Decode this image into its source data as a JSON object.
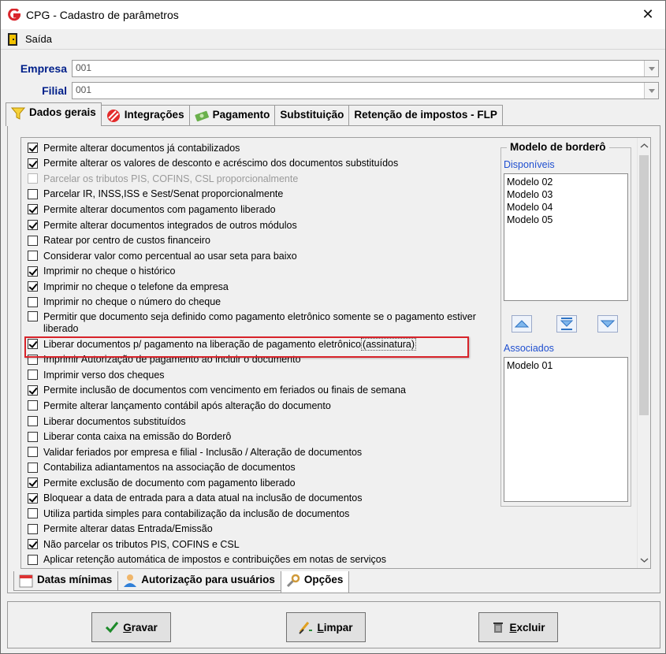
{
  "window": {
    "title": "CPG - Cadastro de parâmetros",
    "close_glyph": "✕"
  },
  "menu": {
    "exit_label": "Saída"
  },
  "fields": {
    "empresa_label": "Empresa",
    "empresa_value": "001",
    "filial_label": "Filial",
    "filial_value": "001"
  },
  "tabs": [
    {
      "label": "Dados gerais",
      "icon": "funnel-icon",
      "active": true
    },
    {
      "label": "Integrações",
      "icon": "stripes-icon",
      "active": false
    },
    {
      "label": "Pagamento",
      "icon": "money-icon",
      "active": false
    },
    {
      "label": "Substituição",
      "icon": "",
      "active": false
    },
    {
      "label": "Retenção de impostos - FLP",
      "icon": "",
      "active": false
    }
  ],
  "options": [
    {
      "label": "Permite alterar documentos já contabilizados",
      "checked": true,
      "disabled": false
    },
    {
      "label": "Permite alterar os valores de desconto e acréscimo dos documentos substituídos",
      "checked": true,
      "disabled": false
    },
    {
      "label": "Parcelar os tributos PIS, COFINS, CSL proporcionalmente",
      "checked": false,
      "disabled": true
    },
    {
      "label": "Parcelar IR, INSS,ISS e Sest/Senat proporcionalmente",
      "checked": false,
      "disabled": false
    },
    {
      "label": "Permite alterar documentos com pagamento liberado",
      "checked": true,
      "disabled": false
    },
    {
      "label": "Permite alterar documentos integrados de outros módulos",
      "checked": true,
      "disabled": false
    },
    {
      "label": "Ratear por centro de custos financeiro",
      "checked": false,
      "disabled": false
    },
    {
      "label": "Considerar valor como percentual ao usar seta para baixo",
      "checked": false,
      "disabled": false
    },
    {
      "label": "Imprimir no cheque o histórico",
      "checked": true,
      "disabled": false
    },
    {
      "label": "Imprimir no cheque o telefone da empresa",
      "checked": true,
      "disabled": false
    },
    {
      "label": "Imprimir no cheque o número do cheque",
      "checked": false,
      "disabled": false
    },
    {
      "label": "Permitir que documento seja definido como pagamento eletrônico somente se o pagamento estiver liberado",
      "checked": false,
      "disabled": false,
      "tall": true
    },
    {
      "label": "Liberar documentos p/ pagamento na liberação de pagamento eletrônico",
      "label_focus": "(assinatura)",
      "checked": true,
      "disabled": false,
      "highlighted": true
    },
    {
      "label": "Imprimir Autorização de pagamento ao incluir o documento",
      "checked": false,
      "disabled": false
    },
    {
      "label": "Imprimir verso dos cheques",
      "checked": false,
      "disabled": false
    },
    {
      "label": "Permite inclusão de documentos com vencimento em feriados ou finais de semana",
      "checked": true,
      "disabled": false
    },
    {
      "label": "Permite alterar lançamento contábil após alteração do documento",
      "checked": false,
      "disabled": false
    },
    {
      "label": "Liberar documentos substituídos",
      "checked": false,
      "disabled": false
    },
    {
      "label": "Liberar conta caixa na emissão do Borderô",
      "checked": false,
      "disabled": false
    },
    {
      "label": "Validar feriados por empresa e filial - Inclusão / Alteração de documentos",
      "checked": false,
      "disabled": false
    },
    {
      "label": "Contabiliza adiantamentos na associação de documentos",
      "checked": false,
      "disabled": false
    },
    {
      "label": "Permite exclusão de documento com pagamento liberado",
      "checked": true,
      "disabled": false
    },
    {
      "label": "Bloquear a data de entrada para a data atual na inclusão de documentos",
      "checked": true,
      "disabled": false
    },
    {
      "label": "Utiliza partida simples para contabilização da inclusão de documentos",
      "checked": false,
      "disabled": false
    },
    {
      "label": "Permite alterar datas Entrada/Emissão",
      "checked": false,
      "disabled": false
    },
    {
      "label": "Não parcelar os tributos PIS, COFINS e CSL",
      "checked": true,
      "disabled": false
    },
    {
      "label": "Aplicar retenção automática de impostos e contribuições em notas de serviços",
      "checked": false,
      "disabled": false
    }
  ],
  "bordero": {
    "title": "Modelo de borderô",
    "available_label": "Disponíveis",
    "available": [
      "Modelo 02",
      "Modelo 03",
      "Modelo 04",
      "Modelo 05"
    ],
    "associated_label": "Associados",
    "associated": [
      "Modelo 01"
    ]
  },
  "bottom_tabs": [
    {
      "label": "Datas mínimas",
      "icon": "calendar-icon",
      "active": false
    },
    {
      "label": "Autorização para usuários",
      "icon": "user-icon",
      "active": false
    },
    {
      "label": "Opções",
      "icon": "wrench-icon",
      "active": true
    }
  ],
  "buttons": {
    "save_first": "G",
    "save_rest": "ravar",
    "clear_first": "L",
    "clear_rest": "impar",
    "delete_first": "E",
    "delete_rest": "xcluir"
  },
  "colors": {
    "highlight": "#d8232a",
    "accent_blue": "#00208a",
    "link_blue": "#1f4fd0"
  }
}
